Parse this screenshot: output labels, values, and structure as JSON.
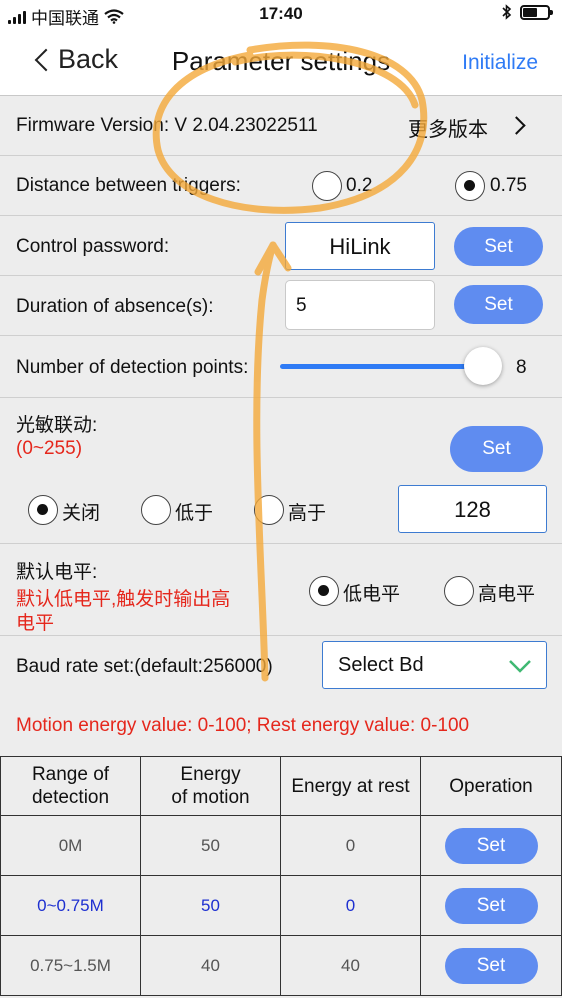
{
  "status_bar": {
    "carrier": "中国联通",
    "time": "17:40"
  },
  "nav": {
    "back_label": "Back",
    "title": "Parameter settings",
    "action_label": "Initialize"
  },
  "firmware": {
    "label": "Firmware Version: V 2.04.23022511",
    "more_label": "更多版本"
  },
  "trigger_distance": {
    "label": "Distance between triggers:",
    "options": [
      "0.2",
      "0.75"
    ],
    "selected": "0.75"
  },
  "password": {
    "label": "Control password:",
    "value": "HiLink",
    "button": "Set"
  },
  "absence": {
    "label": "Duration of absence(s):",
    "value": "5",
    "button": "Set"
  },
  "detection_points": {
    "label": "Number of detection points:",
    "value": "8",
    "slider_fraction": 1.0
  },
  "light": {
    "label": "光敏联动:",
    "range": "(0~255)",
    "button": "Set",
    "options": [
      "关闭",
      "低于",
      "高于"
    ],
    "selected": "关闭",
    "value": "128"
  },
  "level": {
    "label": "默认电平:",
    "note_line1": "默认低电平,触发时输出高",
    "note_line2": "电平",
    "options": [
      "低电平",
      "高电平"
    ],
    "selected": "低电平"
  },
  "baud": {
    "label": "Baud rate set:(default:256000)",
    "select_value": "Select Bd"
  },
  "energy_note": "Motion energy value: 0-100; Rest energy value: 0-100",
  "table": {
    "headers": [
      [
        "Range of",
        "detection"
      ],
      [
        "Energy",
        "of motion"
      ],
      [
        "Energy at rest"
      ],
      [
        "Operation"
      ]
    ],
    "rows": [
      {
        "range": "0M",
        "motion": "50",
        "rest": "0",
        "button": "Set"
      },
      {
        "range": "0~0.75M",
        "motion": "50",
        "rest": "0",
        "button": "Set"
      },
      {
        "range": "0.75~1.5M",
        "motion": "40",
        "rest": "40",
        "button": "Set"
      }
    ]
  },
  "colors": {
    "accent": "#2f7bf5",
    "button": "#5f8cf0",
    "warning": "#e5271c",
    "highlight_row": "#1d2fd0",
    "scribble": "#f4a93a"
  }
}
